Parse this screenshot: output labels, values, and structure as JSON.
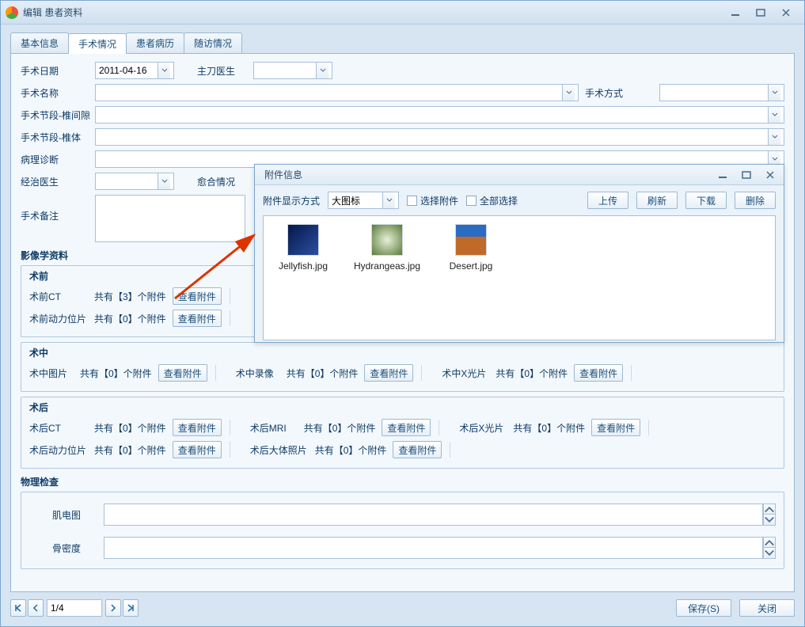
{
  "window": {
    "title": "编辑 患者资料"
  },
  "tabs": [
    "基本信息",
    "手术情况",
    "患者病历",
    "随访情况"
  ],
  "active_tab": 1,
  "fields": {
    "surgery_date_label": "手术日期",
    "surgery_date_value": "2011-04-16",
    "surgeon_label": "主刀医生",
    "surgeon_value": "",
    "surgery_name_label": "手术名称",
    "surgery_method_label": "手术方式",
    "segment_intervertebral_label": "手术节段-椎间隙",
    "segment_vertebra_label": "手术节段-椎体",
    "pathology_label": "病理诊断",
    "attending_label": "经治医生",
    "healing_label": "愈合情况",
    "note_label": "手术备注"
  },
  "imaging": {
    "title": "影像学资料",
    "pre": {
      "title": "术前",
      "items": [
        {
          "label": "术前CT",
          "count": "共有【3】个附件",
          "btn": "查看附件"
        },
        {
          "label": "术前动力位片",
          "count": "共有【0】个附件",
          "btn": "查看附件"
        }
      ]
    },
    "intra": {
      "title": "术中",
      "items": [
        {
          "label": "术中图片",
          "count": "共有【0】个附件",
          "btn": "查看附件"
        },
        {
          "label": "术中录像",
          "count": "共有【0】个附件",
          "btn": "查看附件"
        },
        {
          "label": "术中X光片",
          "count": "共有【0】个附件",
          "btn": "查看附件"
        }
      ]
    },
    "post": {
      "title": "术后",
      "items": [
        {
          "label": "术后CT",
          "count": "共有【0】个附件",
          "btn": "查看附件"
        },
        {
          "label": "术后MRI",
          "count": "共有【0】个附件",
          "btn": "查看附件"
        },
        {
          "label": "术后X光片",
          "count": "共有【0】个附件",
          "btn": "查看附件"
        },
        {
          "label": "术后动力位片",
          "count": "共有【0】个附件",
          "btn": "查看附件"
        },
        {
          "label": "术后大体照片",
          "count": "共有【0】个附件",
          "btn": "查看附件"
        }
      ]
    }
  },
  "physical": {
    "title": "物理检查",
    "emg_label": "肌电图",
    "bone_density_label": "骨密度"
  },
  "footer": {
    "page": "1/4",
    "save": "保存(S)",
    "close": "关闭"
  },
  "dialog": {
    "title": "附件信息",
    "display_mode_label": "附件显示方式",
    "display_mode_value": "大图标",
    "select_attachment": "选择附件",
    "select_all": "全部选择",
    "upload": "上传",
    "refresh": "刷新",
    "download": "下载",
    "delete": "删除",
    "files": [
      {
        "name": "Jellyfish.jpg",
        "bg": "linear-gradient(135deg,#05184a,#2a4fa0)"
      },
      {
        "name": "Hydrangeas.jpg",
        "bg": "radial-gradient(circle,#e8f0d8,#5a7a3a)"
      },
      {
        "name": "Desert.jpg",
        "bg": "linear-gradient(#2a6bc4 0 40%,#c06a2a 40% 100%)"
      }
    ]
  }
}
